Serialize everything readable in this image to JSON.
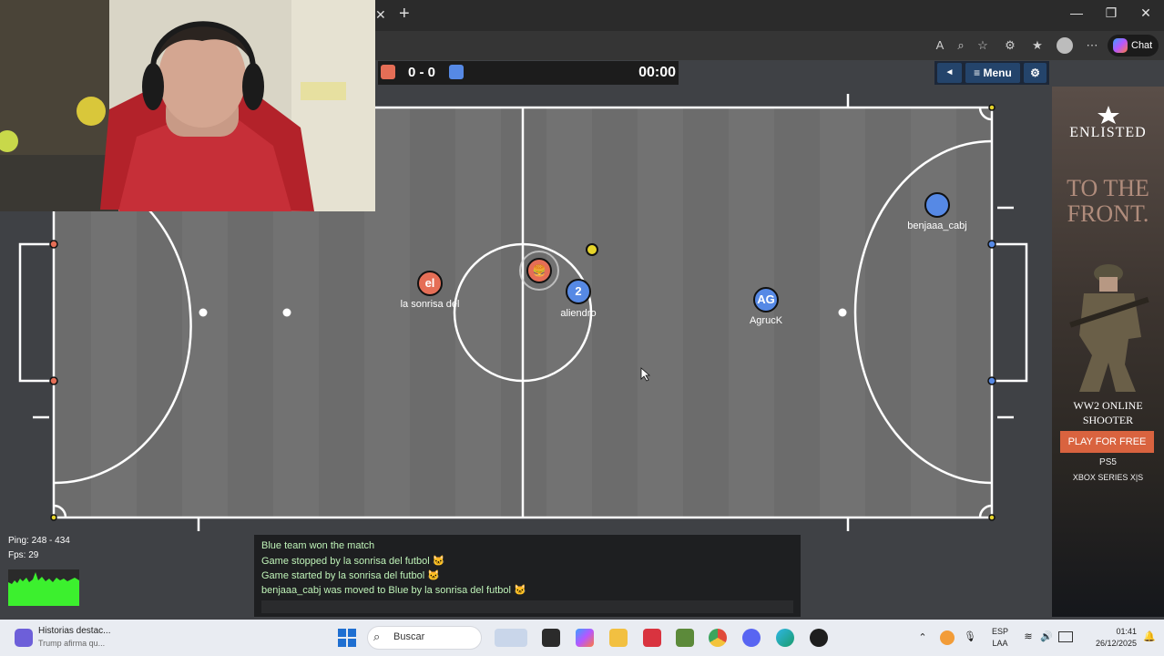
{
  "browser": {
    "new_tab_label": "+",
    "chat_label": "Chat"
  },
  "game": {
    "score": "0 - 0",
    "timer": "00:00",
    "menu_label": "Menu",
    "back_glyph": "◄",
    "players": [
      {
        "team": "red",
        "avatar": "el",
        "name": "la sonrisa del"
      },
      {
        "team": "red",
        "avatar": "🍔",
        "name": ""
      },
      {
        "team": "blue",
        "avatar": "2",
        "name": "aliendro"
      },
      {
        "team": "blue",
        "avatar": "AG",
        "name": "AgrucK"
      },
      {
        "team": "blue",
        "avatar": "",
        "name": "benjaaa_cabj"
      }
    ],
    "colors": {
      "red": "#e56e56",
      "blue": "#5689e5",
      "ball": "#e6d42a",
      "field": "#717171"
    }
  },
  "stats": {
    "ping": "Ping: 248 - 434",
    "fps": "Fps: 29"
  },
  "chat": {
    "messages": [
      "Blue team won the match",
      "Game stopped by la sonrisa del futbol 🐱",
      "Game started by la sonrisa del futbol 🐱",
      "benjaaa_cabj was moved to Blue by la sonrisa del futbol 🐱"
    ]
  },
  "ad": {
    "brand": "ENLISTED",
    "headline": "TO THE FRONT.",
    "subline": "WW2 ONLINE SHOOTER",
    "cta": "PLAY FOR FREE",
    "platform1": "PS5",
    "platform2": "XBOX SERIES X|S"
  },
  "taskbar": {
    "news_title": "Historias destac...",
    "news_sub": "Trump afirma qu...",
    "search_placeholder": "Buscar",
    "lang_top": "ESP",
    "lang_bottom": "LAA",
    "time": "01:41",
    "date": "26/12/2025"
  }
}
